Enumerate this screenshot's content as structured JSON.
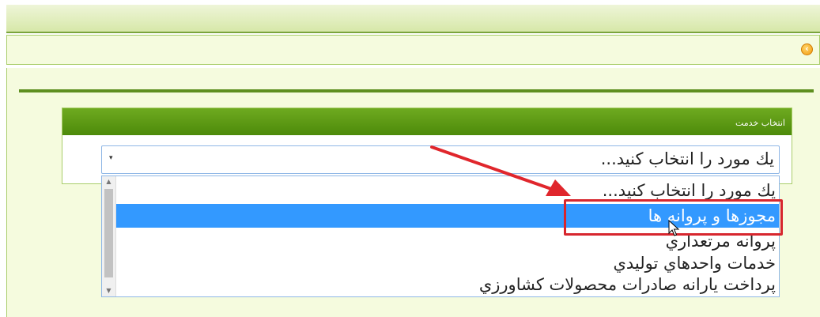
{
  "header": {
    "back_icon": "chevron-left-circle-icon"
  },
  "panel": {
    "title": "انتخاب خدمت",
    "header_color": "#5e9a14"
  },
  "select": {
    "value": "يك مورد را انتخاب كنيد...",
    "caret": "▾"
  },
  "dropdown": {
    "options": [
      "يك مورد را انتخاب كنيد...",
      "مجوزها و پروانه ها",
      "پروانه مرتعداري",
      "خدمات واحدهاي توليدي",
      "پرداخت يارانه صادرات محصولات كشاورزي"
    ],
    "selected_index": 1,
    "selected_color": "#3399ff"
  },
  "annotation": {
    "arrow_color": "#e0262c",
    "box_color": "#d7262e"
  }
}
